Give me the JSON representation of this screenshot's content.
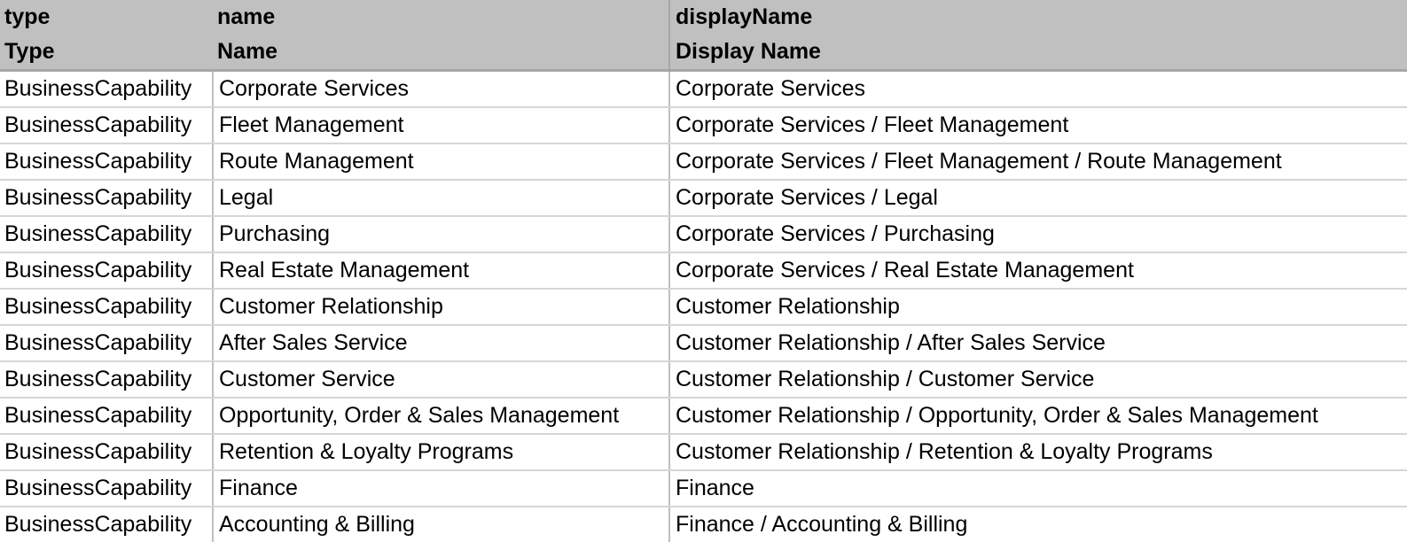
{
  "table": {
    "field_headers": [
      "type",
      "name",
      "displayName"
    ],
    "label_headers": [
      "Type",
      "Name",
      "Display Name"
    ],
    "colors": {
      "header_background": "#C0C0C0",
      "header_text": "#000000",
      "body_background": "#FFFFFF",
      "body_text": "#000000",
      "row_separator": "#D6D6D6",
      "column_separator": "#BFBFBF",
      "header_bottom_border": "#A6A6A6"
    },
    "rows": [
      {
        "type": "BusinessCapability",
        "name": "Corporate Services",
        "displayName": "Corporate Services"
      },
      {
        "type": "BusinessCapability",
        "name": "Fleet Management",
        "displayName": "Corporate Services / Fleet Management"
      },
      {
        "type": "BusinessCapability",
        "name": "Route Management",
        "displayName": "Corporate Services / Fleet Management / Route Management"
      },
      {
        "type": "BusinessCapability",
        "name": "Legal",
        "displayName": "Corporate Services / Legal"
      },
      {
        "type": "BusinessCapability",
        "name": "Purchasing",
        "displayName": "Corporate Services / Purchasing"
      },
      {
        "type": "BusinessCapability",
        "name": "Real Estate Management",
        "displayName": "Corporate Services / Real Estate Management"
      },
      {
        "type": "BusinessCapability",
        "name": "Customer Relationship",
        "displayName": "Customer Relationship"
      },
      {
        "type": "BusinessCapability",
        "name": "After Sales Service",
        "displayName": "Customer Relationship / After Sales Service"
      },
      {
        "type": "BusinessCapability",
        "name": "Customer Service",
        "displayName": "Customer Relationship / Customer Service"
      },
      {
        "type": "BusinessCapability",
        "name": "Opportunity, Order & Sales Management",
        "displayName": "Customer Relationship / Opportunity, Order & Sales Management"
      },
      {
        "type": "BusinessCapability",
        "name": "Retention & Loyalty Programs",
        "displayName": "Customer Relationship / Retention & Loyalty Programs"
      },
      {
        "type": "BusinessCapability",
        "name": "Finance",
        "displayName": "Finance"
      },
      {
        "type": "BusinessCapability",
        "name": "Accounting & Billing",
        "displayName": "Finance / Accounting & Billing"
      }
    ]
  }
}
